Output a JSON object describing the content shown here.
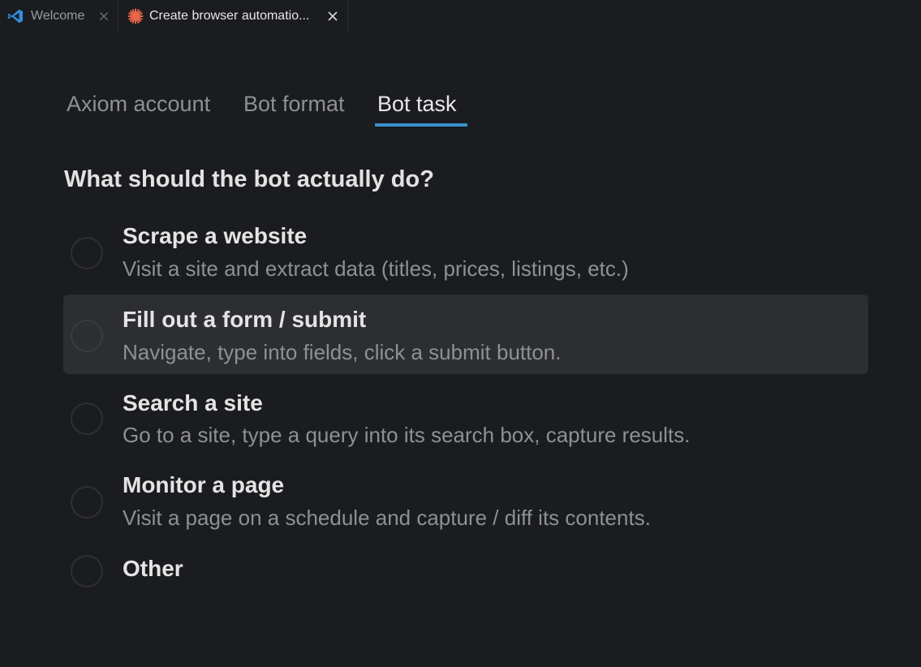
{
  "tabs": [
    {
      "label": "Welcome",
      "icon": "vscode-icon",
      "active": false
    },
    {
      "label": "Create browser automatio...",
      "icon": "sparkle-icon",
      "active": true
    }
  ],
  "steps": {
    "items": [
      "Axiom account",
      "Bot format",
      "Bot task"
    ],
    "active_index": 2,
    "accent_color": "#3b8fd0"
  },
  "question": "What should the bot actually do?",
  "options": [
    {
      "title": "Scrape a website",
      "description": "Visit a site and extract data (titles, prices, listings, etc.)",
      "selected": false,
      "hovered": false
    },
    {
      "title": "Fill out a form / submit",
      "description": "Navigate, type into fields, click a submit button.",
      "selected": false,
      "hovered": true
    },
    {
      "title": "Search a site",
      "description": "Go to a site, type a query into its search box, capture results.",
      "selected": false,
      "hovered": false
    },
    {
      "title": "Monitor a page",
      "description": "Visit a page on a schedule and capture / diff its contents.",
      "selected": false,
      "hovered": false
    },
    {
      "title": "Other",
      "description": "",
      "selected": false,
      "hovered": false
    }
  ]
}
